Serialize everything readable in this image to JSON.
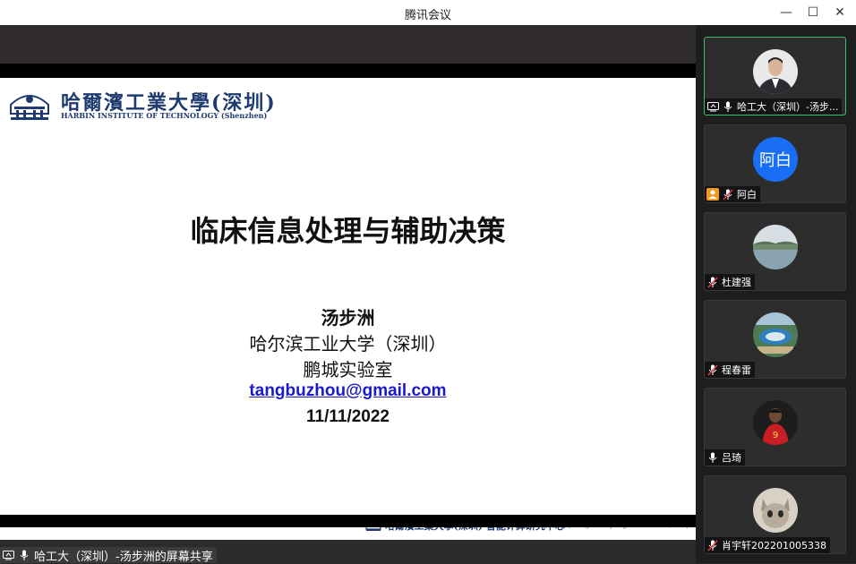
{
  "window": {
    "title": "腾讯会议",
    "minimize_glyph": "—",
    "maximize_glyph": "☐",
    "close_glyph": "✕"
  },
  "slide": {
    "logo_cn": "哈爾濱工業大學(深圳)",
    "logo_en": "HARBIN INSTITUTE OF TECHNOLOGY (Shenzhen)",
    "title": "临床信息处理与辅助决策",
    "author": "汤步洲",
    "affiliation": "哈尔滨工业大学（深圳）",
    "lab": "鹏城实验室",
    "email": "tangbuzhou@gmail.com",
    "date": "11/11/2022",
    "footer_cn": "哈爾濱工業大學(深圳)  智能计算研究中心",
    "footer_en": "(Intelligent Computing Research Center, ICRC)"
  },
  "share_bar": {
    "text": "哈工大（深圳）-汤步洲的屏幕共享"
  },
  "participants": [
    {
      "name": "哈工大（深圳）-汤步...",
      "avatar": "photo-man-suit",
      "mic": "on",
      "sharing": true,
      "active": true
    },
    {
      "name": "阿白",
      "avatar_text": "阿白",
      "avatar_color": "#1a6ef5",
      "mic": "muted",
      "host_badge": true
    },
    {
      "name": "杜建强",
      "avatar": "photo-lake",
      "mic": "muted"
    },
    {
      "name": "程春雷",
      "avatar": "photo-aerial-stadium",
      "mic": "muted"
    },
    {
      "name": "吕琦",
      "avatar": "photo-football-player",
      "mic": "on"
    },
    {
      "name": "肖宇轩202201005338",
      "avatar": "photo-cat",
      "mic": "muted"
    }
  ],
  "colors": {
    "accent_active": "#35c06a",
    "host_badge": "#f39a21",
    "avatar_blue": "#1a6ef5"
  }
}
